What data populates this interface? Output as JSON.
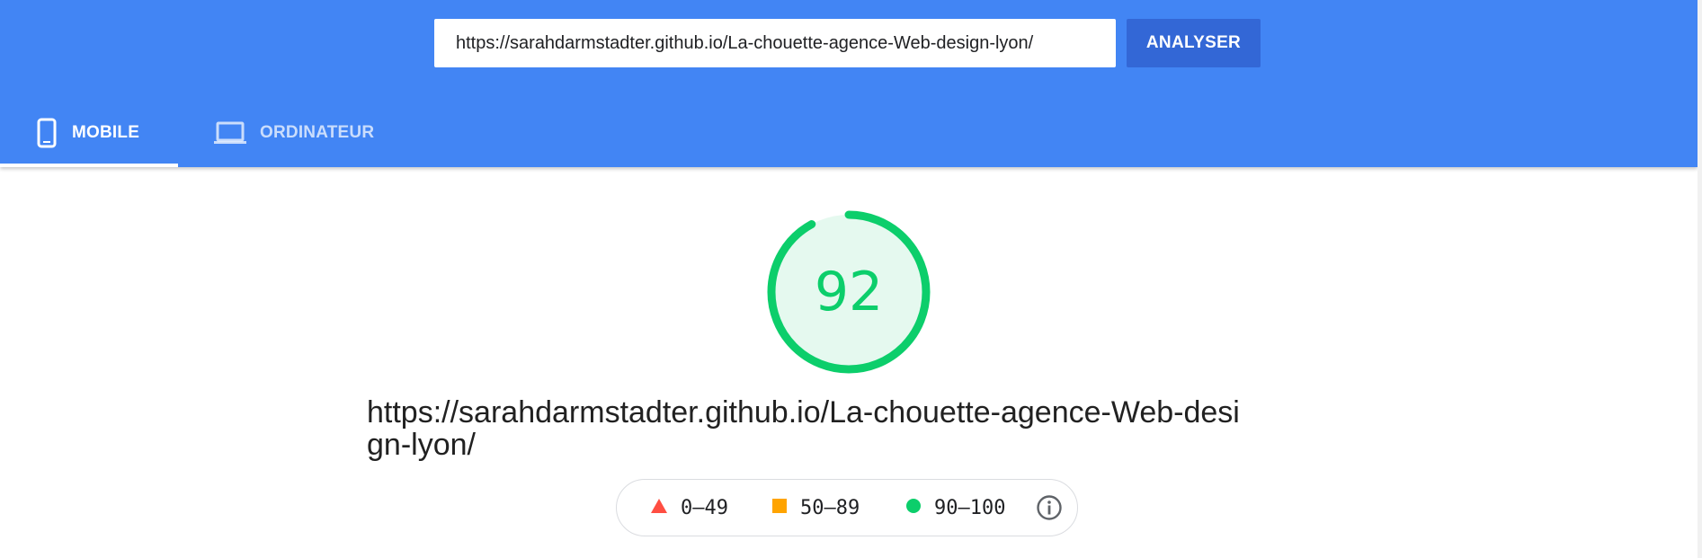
{
  "search": {
    "url_value": "https://sarahdarmstadter.github.io/La-chouette-agence-Web-design-lyon/",
    "analyze_label": "ANALYSER"
  },
  "tabs": [
    {
      "label": "MOBILE",
      "icon": "smartphone-icon",
      "selected": true
    },
    {
      "label": "ORDINATEUR",
      "icon": "laptop-icon",
      "selected": false
    }
  ],
  "report": {
    "score": "92",
    "score_fraction": 0.92,
    "final_url": "https://sarahdarmstadter.github.io/La-chouette-agence-Web-design-lyon/"
  },
  "legend": {
    "items": [
      {
        "range": "0–49",
        "shape": "triangle",
        "color": "#ff4e42"
      },
      {
        "range": "50–89",
        "shape": "square",
        "color": "#ffa400"
      },
      {
        "range": "90–100",
        "shape": "circle",
        "color": "#0cce6b"
      }
    ],
    "info_icon": "info-icon"
  },
  "colors": {
    "header_bg": "#4285f4",
    "button_bg": "#3367d6",
    "pass_green": "#0cce6b",
    "gauge_fill": "#e5f9ef"
  }
}
